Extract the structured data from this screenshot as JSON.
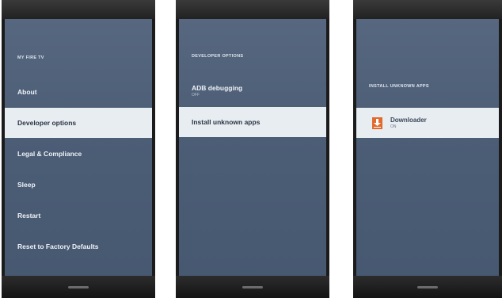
{
  "panel1": {
    "section_title": "MY FIRE TV",
    "items": [
      {
        "label": "About",
        "selected": false
      },
      {
        "label": "Developer options",
        "selected": true
      },
      {
        "label": "Legal & Compliance",
        "selected": false
      },
      {
        "label": "Sleep",
        "selected": false
      },
      {
        "label": "Restart",
        "selected": false
      },
      {
        "label": "Reset to Factory Defaults",
        "selected": false
      }
    ]
  },
  "panel2": {
    "section_title": "DEVELOPER OPTIONS",
    "adb": {
      "label": "ADB debugging",
      "value": "OFF"
    },
    "install_unknown": {
      "label": "Install unknown apps"
    }
  },
  "panel3": {
    "section_title": "INSTALL UNKNOWN APPS",
    "app": {
      "label": "Downloader",
      "value": "ON",
      "icon": "download-arrow-icon",
      "icon_color": "#e26a2c"
    }
  }
}
